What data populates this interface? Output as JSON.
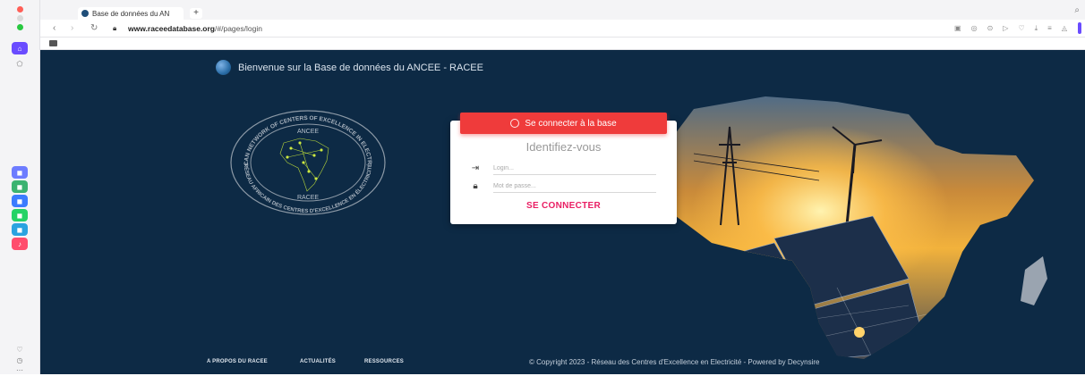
{
  "browser": {
    "tab_title": "Base de données du AN",
    "new_tab": "+",
    "url_host": "www.raceedatabase.org",
    "url_path": "/#/pages/login",
    "back": "‹",
    "forward": "›",
    "reload": "↻"
  },
  "header": {
    "welcome": "Bienvenue sur la Base de données du ANCEE - RACEE"
  },
  "logo": {
    "top_text": "AFRICAN NETWORK OF CENTERS OF EXCELLENCE IN ELECTRICITY",
    "bottom_text": "RÉSEAU AFRICAIN DES CENTRES D'EXCELLENCE EN ÉLECTRICITÉ",
    "inner_top": "ANCEE",
    "inner_bottom": "RACEE"
  },
  "login": {
    "header": "Se connecter à la base",
    "title": "Identifiez-vous",
    "login_placeholder": "Login...",
    "password_placeholder": "Mot de passe...",
    "submit": "SE CONNECTER"
  },
  "footer": {
    "links": [
      "A PROPOS DU RACEE",
      "ACTUALITÉS",
      "RESSOURCES"
    ],
    "copyright": "© Copyright 2023 - Réseau des Centres d'Excellence en Electricité - Powered by Decynsire"
  },
  "colors": {
    "page_bg": "#0d2a45",
    "accent_red": "#ef3b3b",
    "submit_pink": "#e91e63"
  }
}
